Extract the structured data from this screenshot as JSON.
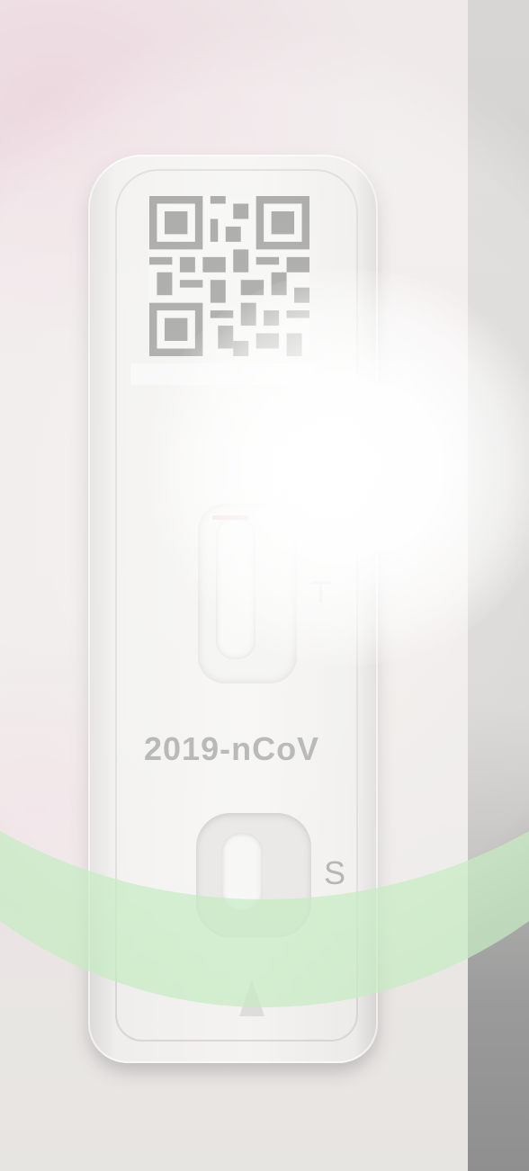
{
  "device": {
    "brand_text": "2019-nCoV",
    "test_marker": "T",
    "sample_marker": "S"
  },
  "colors": {
    "background": "#ebe8e6",
    "cassette": "#f4f3f1",
    "control_line": "#e0b0b8",
    "overlay_green": "#c6ecc2",
    "label_text": "#9d9d9b"
  },
  "icons": [
    "qr-code-icon",
    "arrow-up-icon"
  ]
}
